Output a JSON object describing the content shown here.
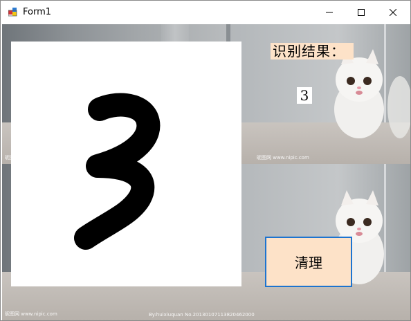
{
  "window": {
    "title": "Form1"
  },
  "titlebar": {
    "icons": [
      "app-icon",
      "minimize-icon",
      "maximize-icon",
      "close-icon"
    ]
  },
  "form": {
    "result_label": "识别结果：",
    "result_value": "3",
    "clear_button": "清理",
    "watermark_left": "昵图网 www.nipic.com",
    "watermark_right": "By:huixiuquan No.20130107113820462000"
  },
  "colors": {
    "label_bg": "#fde2c8",
    "button_border": "#1d74d0",
    "canvas_bg": "#ffffff",
    "stroke": "#000000"
  }
}
